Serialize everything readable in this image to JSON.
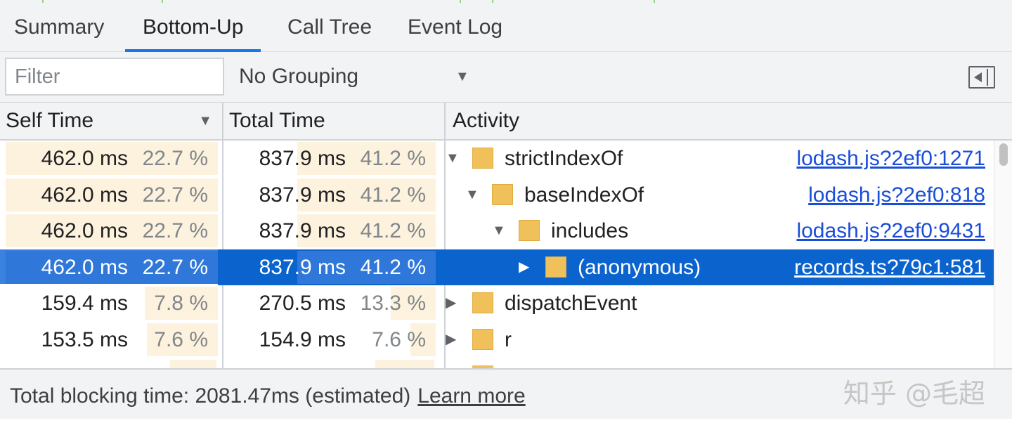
{
  "tabs": [
    {
      "label": "Summary",
      "active": false
    },
    {
      "label": "Bottom-Up",
      "active": true
    },
    {
      "label": "Call Tree",
      "active": false
    },
    {
      "label": "Event Log",
      "active": false
    }
  ],
  "toolbar": {
    "filter_placeholder": "Filter",
    "filter_value": "",
    "grouping_value": "No Grouping"
  },
  "columns": {
    "self_time": "Self Time",
    "total_time": "Total Time",
    "activity": "Activity"
  },
  "rows": [
    {
      "self": "462.0 ms",
      "self_pct": "22.7 %",
      "self_frac": 0.227,
      "total": "837.9 ms",
      "total_pct": "41.2 %",
      "total_frac": 0.412,
      "name": "strictIndexOf",
      "source": "lodash.js?2ef0:1271",
      "depth": 0,
      "expanded": true,
      "selected": false
    },
    {
      "self": "462.0 ms",
      "self_pct": "22.7 %",
      "self_frac": 0.227,
      "total": "837.9 ms",
      "total_pct": "41.2 %",
      "total_frac": 0.412,
      "name": "baseIndexOf",
      "source": "lodash.js?2ef0:818",
      "depth": 1,
      "expanded": true,
      "selected": false
    },
    {
      "self": "462.0 ms",
      "self_pct": "22.7 %",
      "self_frac": 0.227,
      "total": "837.9 ms",
      "total_pct": "41.2 %",
      "total_frac": 0.412,
      "name": "includes",
      "source": "lodash.js?2ef0:9431",
      "depth": 2,
      "expanded": true,
      "selected": false
    },
    {
      "self": "462.0 ms",
      "self_pct": "22.7 %",
      "self_frac": 0.227,
      "total": "837.9 ms",
      "total_pct": "41.2 %",
      "total_frac": 0.412,
      "name": "(anonymous)",
      "source": "records.ts?79c1:581",
      "depth": 3,
      "expanded": false,
      "selected": true
    },
    {
      "self": "159.4 ms",
      "self_pct": "7.8 %",
      "self_frac": 0.078,
      "total": "270.5 ms",
      "total_pct": "13.3 %",
      "total_frac": 0.133,
      "name": "dispatchEvent",
      "source": "",
      "depth": 0,
      "expanded": false,
      "selected": false
    },
    {
      "self": "153.5 ms",
      "self_pct": "7.6 %",
      "self_frac": 0.076,
      "total": "154.9 ms",
      "total_pct": "7.6 %",
      "total_frac": 0.076,
      "name": "r",
      "source": "",
      "depth": 0,
      "expanded": false,
      "selected": false
    }
  ],
  "footer": {
    "text": "Total blocking time: 2081.47ms (estimated)",
    "link": "Learn more"
  },
  "watermark": "知乎 @毛超",
  "icons": {
    "sort": "sort-descending-icon",
    "dropdown": "dropdown-caret-icon",
    "sidebar": "toggle-sidebar-icon"
  },
  "colors": {
    "accent": "#1a73e8",
    "selection": "#0b63ce",
    "swatch": "#f0c15a",
    "bar": "#fdf2dd",
    "link": "#1a4ed8"
  }
}
